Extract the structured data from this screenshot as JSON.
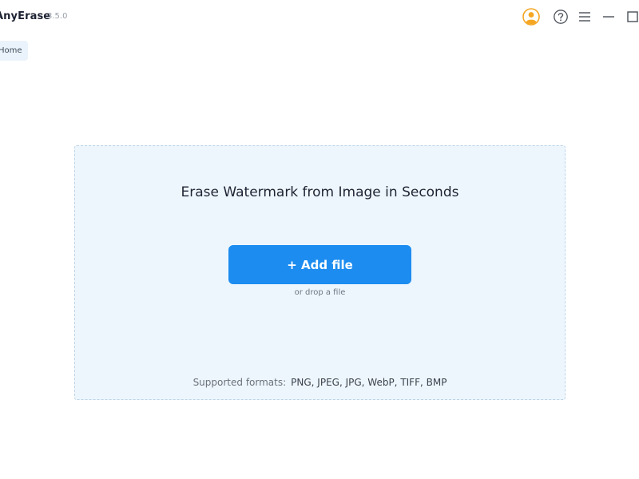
{
  "app": {
    "name": "AnyErase",
    "version": "3.5.0"
  },
  "window_controls": {
    "icons": [
      "account-icon",
      "help-icon",
      "menu-icon",
      "minimize-icon",
      "maximize-icon"
    ]
  },
  "nav": {
    "home_label": "Home"
  },
  "upload": {
    "headline": "Erase Watermark from Image in Seconds",
    "add_button_label": "+ Add file",
    "drop_hint": "or drop a file",
    "formats_label": "Supported formats:",
    "formats_list": "PNG, JPEG, JPG, WebP, TIFF, BMP"
  },
  "colors": {
    "accent": "#1c8cf0",
    "account_icon": "#f5a623",
    "drop_zone_bg": "#eef6fd",
    "drop_zone_border": "#bcd3e8"
  }
}
